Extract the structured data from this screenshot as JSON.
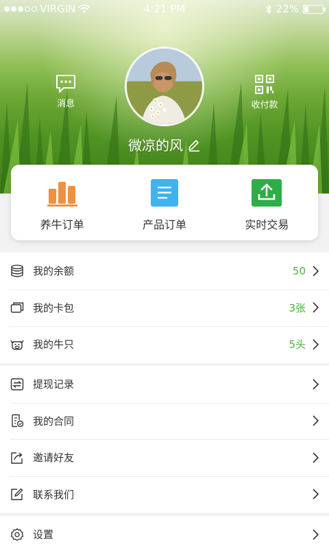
{
  "status_bar": {
    "carrier": "VIRGIN",
    "time": "4:21 PM",
    "battery_text": "22%",
    "battery_level": 0.22
  },
  "header": {
    "message_label": "消息",
    "pay_label": "收付款",
    "username": "微凉的风"
  },
  "orders": [
    {
      "label": "养牛订单",
      "icon": "bar-chart-icon",
      "color": "#f0913f"
    },
    {
      "label": "产品订单",
      "icon": "document-list-icon",
      "color": "#3eb3ef"
    },
    {
      "label": "实时交易",
      "icon": "upload-tray-icon",
      "color": "#2fae47"
    }
  ],
  "menu": {
    "balance": {
      "label": "我的余额",
      "value": "50"
    },
    "card_wallet": {
      "label": "我的卡包",
      "value": "3张"
    },
    "cattle": {
      "label": "我的牛只",
      "value": "5头"
    },
    "withdraw": {
      "label": "提现记录"
    },
    "contract": {
      "label": "我的合同"
    },
    "invite": {
      "label": "邀请好友"
    },
    "contact": {
      "label": "联系我们"
    },
    "settings": {
      "label": "设置"
    }
  },
  "colors": {
    "accent_green": "#4cae3c",
    "text": "#333333",
    "background": "#f2f2f2"
  }
}
